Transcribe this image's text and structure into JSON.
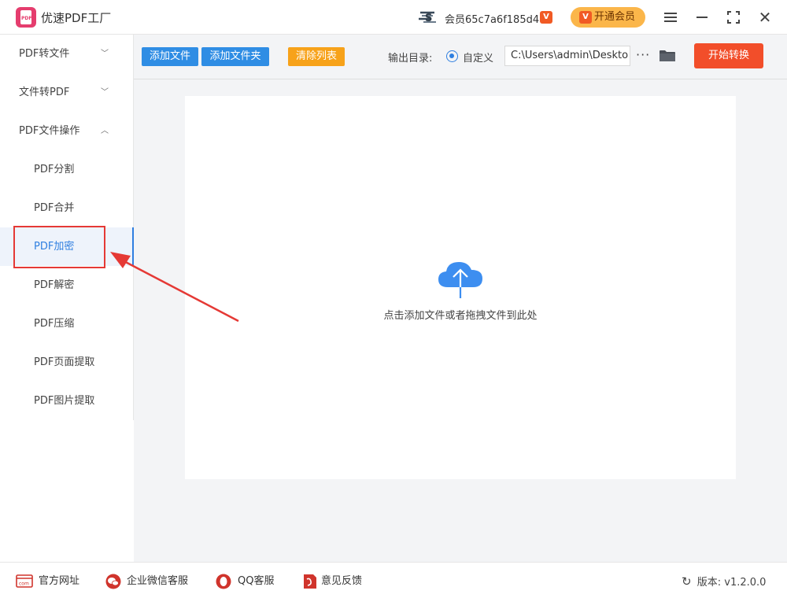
{
  "app": {
    "title": "优速PDF工厂",
    "member_text": "会员65c7a6f185d4",
    "vip_button_label": "开通会员"
  },
  "sidebar": {
    "items": [
      {
        "label": "PDF转文件",
        "type": "group",
        "expanded": false
      },
      {
        "label": "文件转PDF",
        "type": "group",
        "expanded": false
      },
      {
        "label": "PDF文件操作",
        "type": "group",
        "expanded": true
      },
      {
        "label": "PDF分割",
        "type": "sub"
      },
      {
        "label": "PDF合并",
        "type": "sub"
      },
      {
        "label": "PDF加密",
        "type": "sub",
        "active": true
      },
      {
        "label": "PDF解密",
        "type": "sub"
      },
      {
        "label": "PDF压缩",
        "type": "sub"
      },
      {
        "label": "PDF页面提取",
        "type": "sub"
      },
      {
        "label": "PDF图片提取",
        "type": "sub"
      }
    ]
  },
  "toolbar": {
    "add_file_label": "添加文件",
    "add_folder_label": "添加文件夹",
    "clear_list_label": "清除列表",
    "output_dir_label": "输出目录:",
    "custom_label": "自定义",
    "output_path": "C:\\Users\\admin\\Deskto",
    "start_label": "开始转换"
  },
  "dropzone": {
    "hint": "点击添加文件或者拖拽文件到此处"
  },
  "footer": {
    "website_label": "官方网址",
    "wechat_label": "企业微信客服",
    "qq_label": "QQ客服",
    "feedback_label": "意见反馈",
    "version_label": "版本:",
    "version_value": "v1.2.0.0"
  },
  "colors": {
    "accent_blue": "#2f8de4",
    "clear_orange": "#f7a21a",
    "start_red": "#f24e2a",
    "vip_gold": "#fbb64a",
    "annotation_red": "#e53935"
  }
}
